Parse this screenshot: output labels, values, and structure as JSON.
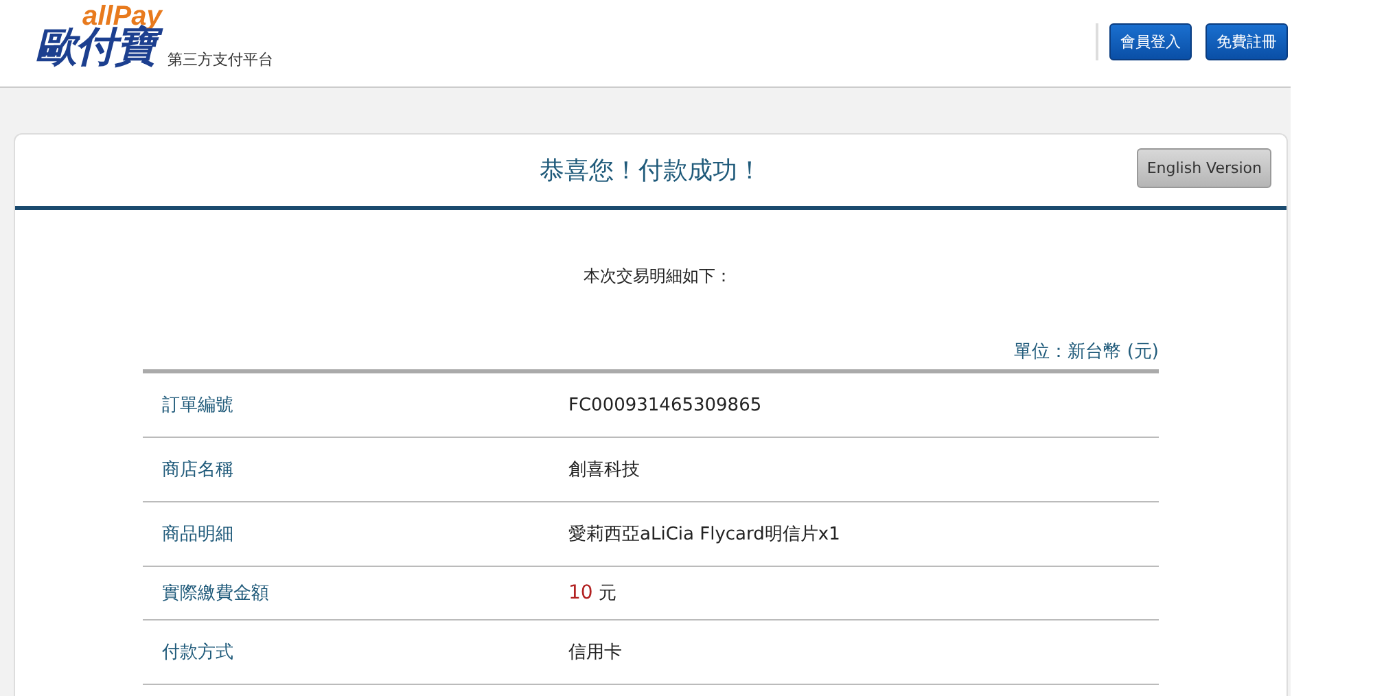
{
  "header": {
    "logo_top": "allPay",
    "logo_main": "歐付寶",
    "tagline": "第三方支付平台",
    "buttons": [
      "會員登入",
      "免費註冊"
    ]
  },
  "card": {
    "title": "恭喜您！付款成功！",
    "language_button": "English Version",
    "intro": "本次交易明細如下：",
    "unit_note": "單位：新台幣 (元)",
    "rows": [
      {
        "kind": "text",
        "label": "訂單編號",
        "value": "FC000931465309865"
      },
      {
        "kind": "text",
        "label": "商店名稱",
        "value": "創喜科技"
      },
      {
        "kind": "text",
        "label": "商品明細",
        "value": "愛莉西亞aLiCia Flycard明信片x1"
      },
      {
        "kind": "amount",
        "label": "實際繳費金額",
        "value": "10",
        "unit": "元"
      },
      {
        "kind": "text",
        "label": "付款方式",
        "value": "信用卡"
      }
    ]
  }
}
